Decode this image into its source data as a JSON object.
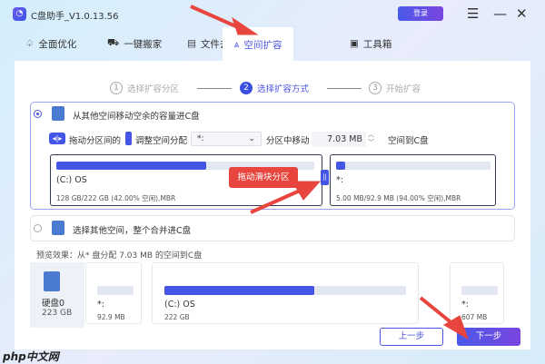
{
  "app": {
    "title": "C盘助手_V1.0.13.56",
    "login": "登录"
  },
  "tabs": [
    {
      "label": "全面优化"
    },
    {
      "label": "一键搬家"
    },
    {
      "label": "文件去重"
    },
    {
      "label": "空间扩容"
    },
    {
      "label": "工具箱"
    }
  ],
  "steps": [
    {
      "num": "1",
      "label": "选择扩容分区"
    },
    {
      "num": "2",
      "label": "选择扩容方式"
    },
    {
      "num": "3",
      "label": "开始扩容"
    }
  ],
  "option1": {
    "label": "从其他空间移动空余的容量进C盘",
    "hint1": "拖动分区间的",
    "hint2": "调整空间分配",
    "select_value": "*:",
    "mid": "分区中移动",
    "amount": "7.03 MB",
    "tail": "空间到C盘",
    "c": {
      "name": "(C:) OS",
      "stats": "128 GB/222 GB (42.00% 空闲),MBR",
      "used_pct": 58
    },
    "other": {
      "name": "*:",
      "stats": "5.00 MB/92.9 MB (94.00% 空闲),MBR",
      "used_pct": 6
    },
    "tooltip": "拖动滑块分区"
  },
  "option2": {
    "label": "选择其他空间，整个合并进C盘"
  },
  "preview": {
    "label": "预览效果：从* 盘分配 7.03 MB 的空间到C盘",
    "disk_name": "硬盘0",
    "disk_size": "223 GB",
    "parts": [
      {
        "name": "*:",
        "size": "92.9 MB",
        "used_pct": 0
      },
      {
        "name": "(C:) OS",
        "size": "222 GB",
        "used_pct": 62
      },
      {
        "name": "*:",
        "size": "607 MB",
        "used_pct": 0
      }
    ]
  },
  "buttons": {
    "prev": "上一步",
    "next": "下一步"
  },
  "watermark": "php中文网"
}
